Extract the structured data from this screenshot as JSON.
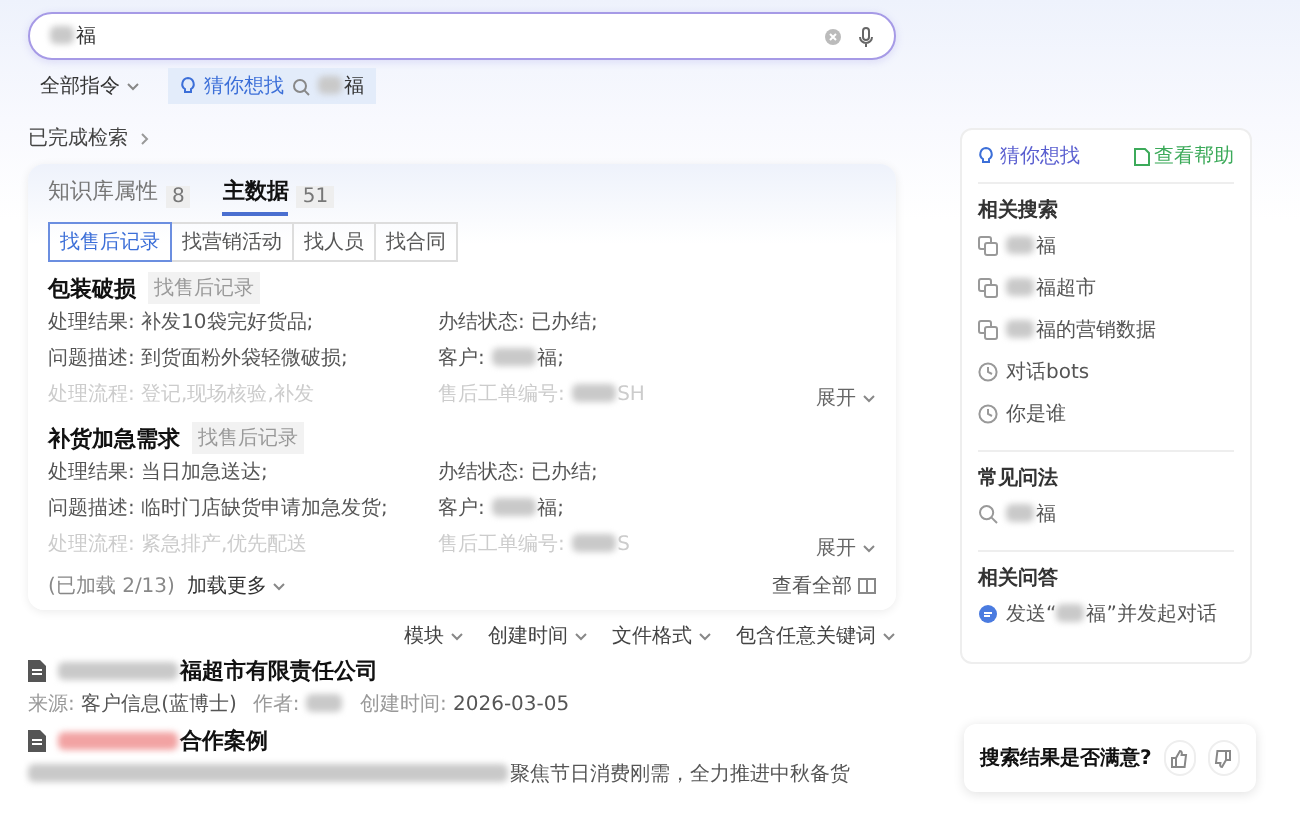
{
  "search": {
    "value": "福",
    "redacted": true,
    "command": "全部指令",
    "guess_label": "猜你想找",
    "guess_item": "福"
  },
  "breadcrumb": "已完成检索",
  "card": {
    "tabs": [
      {
        "label": "知识库属性",
        "count": "8",
        "selected": false
      },
      {
        "label": "主数据",
        "count": "51",
        "selected": true
      }
    ],
    "chips": [
      {
        "label": "找售后记录",
        "selected": true
      },
      {
        "label": "找营销活动",
        "selected": false
      },
      {
        "label": "找人员",
        "selected": false
      },
      {
        "label": "找合同",
        "selected": false
      }
    ],
    "records": [
      {
        "title": "包装破损",
        "tag": "找售后记录",
        "expand": "展开",
        "fields": [
          {
            "label": "处理结果:",
            "value": "补发10袋完好货品;",
            "redacted": false,
            "faded": false
          },
          {
            "label": "办结状态:",
            "value": "已办结;",
            "redacted": false,
            "faded": false
          },
          {
            "label": "问题描述:",
            "value": "到货面粉外袋轻微破损;",
            "redacted": false,
            "faded": false
          },
          {
            "label": "客户:",
            "value": "福;",
            "redacted": true,
            "faded": false
          },
          {
            "label": "处理流程:",
            "value": "登记,现场核验,补发",
            "redacted": false,
            "faded": true
          },
          {
            "label": "售后工单编号:",
            "value": "SH",
            "redacted": true,
            "faded": true
          }
        ]
      },
      {
        "title": "补货加急需求",
        "tag": "找售后记录",
        "expand": "展开",
        "fields": [
          {
            "label": "处理结果:",
            "value": "当日加急送达;",
            "redacted": false,
            "faded": false
          },
          {
            "label": "办结状态:",
            "value": "已办结;",
            "redacted": false,
            "faded": false
          },
          {
            "label": "问题描述:",
            "value": "临时门店缺货申请加急发货;",
            "redacted": false,
            "faded": false
          },
          {
            "label": "客户:",
            "value": "福;",
            "redacted": true,
            "faded": false
          },
          {
            "label": "处理流程:",
            "value": "紧急排产,优先配送",
            "redacted": false,
            "faded": true
          },
          {
            "label": "售后工单编号:",
            "value": "S",
            "redacted": true,
            "faded": true
          }
        ]
      }
    ],
    "loaded": "(已加载 2/13)",
    "load_more": "加载更多",
    "view_all": "查看全部"
  },
  "filters": [
    "模块",
    "创建时间",
    "文件格式",
    "包含任意关键词"
  ],
  "results": [
    {
      "title": "福超市有限责任公司",
      "redacted": true,
      "highlighted": false,
      "meta": [
        {
          "label": "来源:",
          "value": "客户信息(蓝博士)",
          "redacted": false
        },
        {
          "label": "作者:",
          "redacted": true
        },
        {
          "label": "创建时间:",
          "value": "2026-03-05",
          "redacted": false
        }
      ]
    },
    {
      "title": "合作案例",
      "redacted": true,
      "highlighted": true,
      "snippet": "聚焦节日消费刚需，全力推进中秋备货"
    }
  ],
  "side": {
    "title": "猜你想找",
    "help": "查看帮助",
    "sections": [
      {
        "title": "相关搜索",
        "items": [
          {
            "kind": "doc",
            "text": "福"
          },
          {
            "kind": "doc",
            "text": "福超市"
          },
          {
            "kind": "doc",
            "text": "福的营销数据"
          },
          {
            "kind": "history",
            "text": "对话bots"
          },
          {
            "kind": "history",
            "text": "你是谁"
          }
        ]
      },
      {
        "title": "常见问法",
        "items": [
          {
            "kind": "search",
            "text": "福"
          }
        ]
      },
      {
        "title": "相关问答",
        "items": [
          {
            "kind": "chat",
            "prefix": "发送“",
            "text": "福”并发起对话"
          }
        ]
      }
    ]
  },
  "feedback": {
    "question": "搜索结果是否满意?"
  }
}
